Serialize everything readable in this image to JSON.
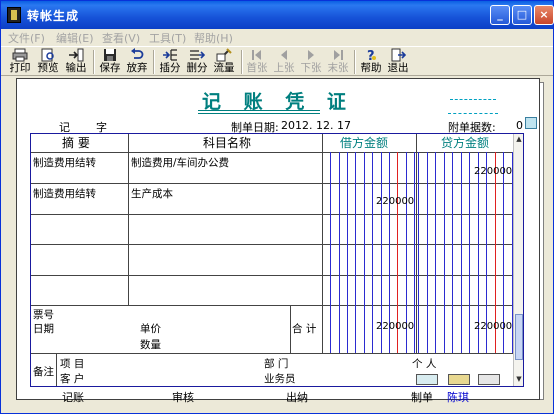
{
  "window": {
    "title": "转帐生成",
    "minimize": "_",
    "maximize": "□",
    "close": "×"
  },
  "menu": [
    "文件(F)",
    "编辑(E)",
    "查看(V)",
    "工具(T)",
    "帮助(H)"
  ],
  "toolbar": {
    "print": "打印",
    "preview": "预览",
    "export": "输出",
    "save": "保存",
    "abandon": "放弃",
    "insert_entry": "插分",
    "delete_entry": "删分",
    "cash_flow": "流量",
    "first": "首张",
    "prev": "上张",
    "next": "下张",
    "last": "末张",
    "help": "帮助",
    "exit": "退出"
  },
  "voucher": {
    "title": "记 账 凭 证",
    "type_label": "记",
    "number_label": "字",
    "date_label": "制单日期:",
    "date": "2012. 12. 17",
    "attachments_label": "附单据数:",
    "attachments": "0"
  },
  "columns": {
    "summary": "摘 要",
    "account": "科目名称",
    "debit": "借方金额",
    "credit": "贷方金额"
  },
  "rows": [
    {
      "summary": "制造费用结转",
      "account": "制造费用/车间办公费",
      "debit": "",
      "credit": "220000"
    },
    {
      "summary": "制造费用结转",
      "account": "生产成本",
      "debit": "220000",
      "credit": ""
    },
    {
      "summary": "",
      "account": "",
      "debit": "",
      "credit": ""
    },
    {
      "summary": "",
      "account": "",
      "debit": "",
      "credit": ""
    },
    {
      "summary": "",
      "account": "",
      "debit": "",
      "credit": ""
    }
  ],
  "totals": {
    "ticket_no_label": "票号",
    "date_label": "日期",
    "unit_price_label": "单价",
    "quantity_label": "数量",
    "total_label": "合 计",
    "debit_total": "220000",
    "credit_total": "220000"
  },
  "remarks": {
    "label": "备注",
    "project_label": "项 目",
    "customer_label": "客 户",
    "department_label": "部 门",
    "salesman_label": "业务员",
    "person_label": "个 人"
  },
  "footer": {
    "bookkeeping": "记账",
    "review": "审核",
    "cashier": "出纳",
    "maker_label": "制单",
    "maker": "陈琪"
  },
  "colors": {
    "title_bar": "#0a5fe3",
    "voucher_title": "#007f7f",
    "grid_border": "#1a1a9e",
    "blue_lines": "#2b2bd0",
    "red_lines": "#e02020",
    "maker_name": "#0000d0"
  }
}
